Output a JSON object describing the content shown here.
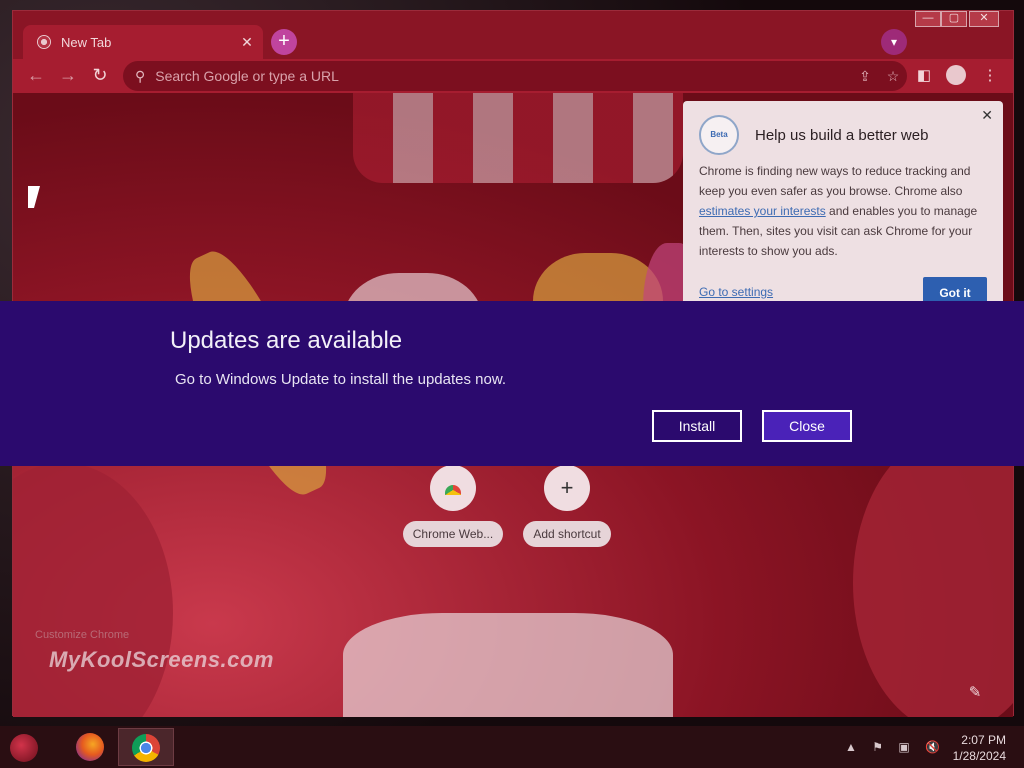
{
  "browser": {
    "tab_title": "New Tab",
    "tab_close": "✕",
    "new_tab_label": "+",
    "omnibox_placeholder": "Search Google or type a URL",
    "window_controls": {
      "minimize": "—",
      "maximize": "▢",
      "close": "✕"
    }
  },
  "ntp": {
    "shortcuts": [
      {
        "label": "Chrome Web...",
        "icon": "chrome-web-store-icon"
      },
      {
        "label": "Add shortcut",
        "icon": "plus-icon"
      }
    ],
    "customize_label": "Customize Chrome",
    "watermark": "MyKoolScreens.com"
  },
  "hats_bubble": {
    "title": "Help us build a better web",
    "badge": "Beta",
    "body_part1": "Chrome is finding new ways to reduce tracking and keep you even safer as you browse. Chrome also ",
    "body_link": "estimates your interests",
    "body_part2": " and enables you to manage them. Then, sites you visit can ask Chrome for your interests to show you ads.",
    "settings_link": "Go to settings",
    "got_it": "Got it"
  },
  "update_banner": {
    "title": "Updates are available",
    "message": "Go to Windows Update to install the updates now.",
    "install_label": "Install",
    "close_label": "Close"
  },
  "taskbar": {
    "time": "2:07 PM",
    "date": "1/28/2024"
  },
  "colors": {
    "theme_red": "#a61d30",
    "banner_purple": "#2b0a6e",
    "got_it_blue": "#2d5fb0"
  }
}
